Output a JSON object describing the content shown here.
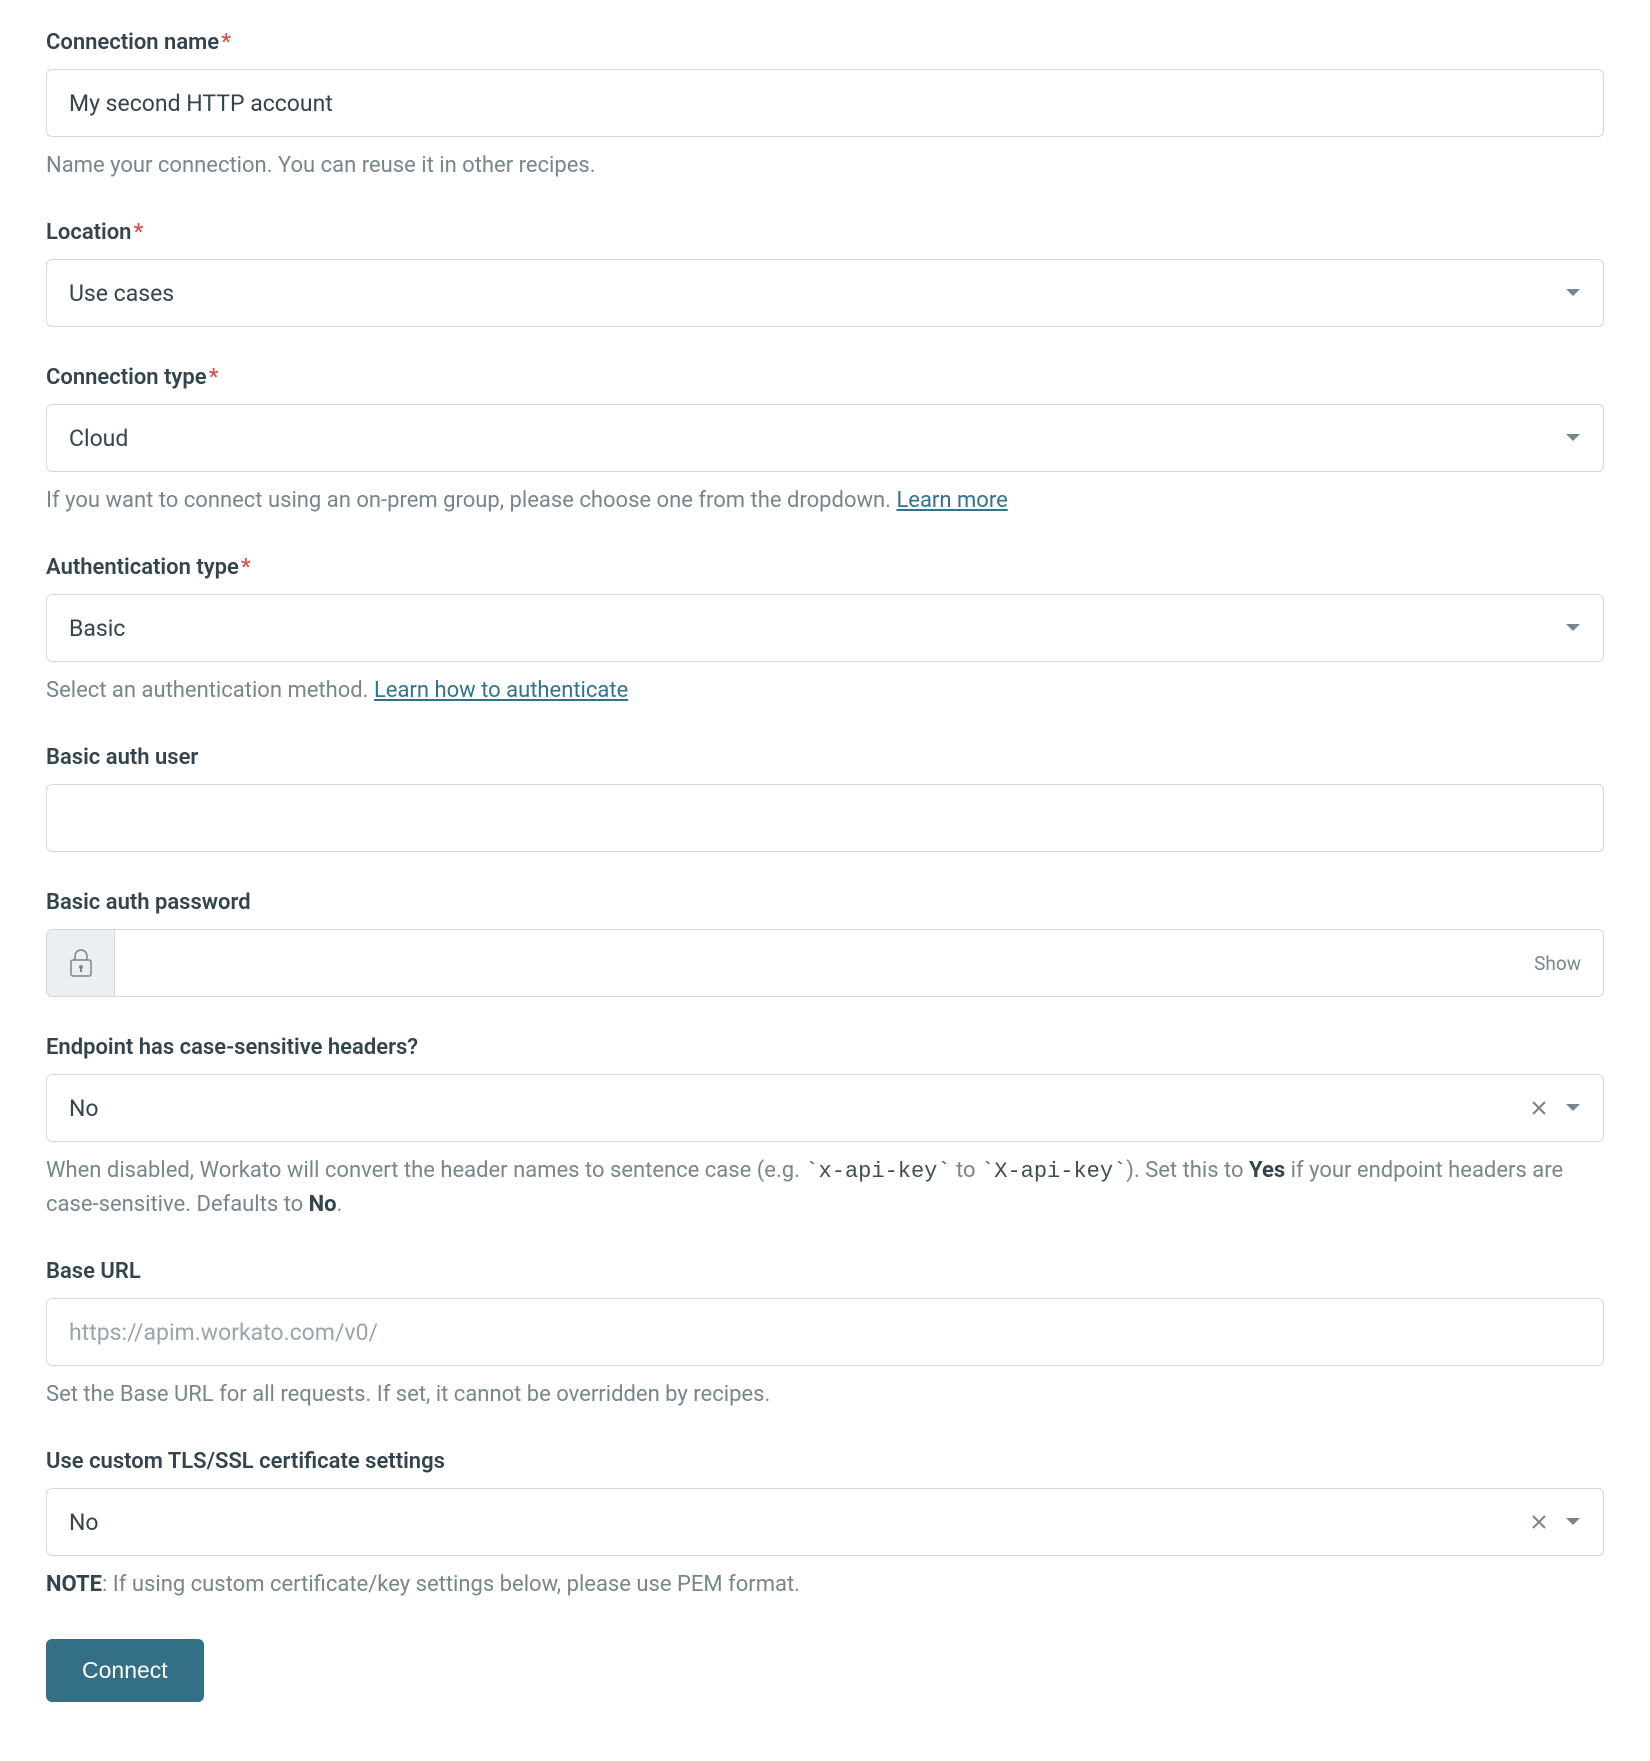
{
  "fields": {
    "connection_name": {
      "label": "Connection name",
      "required": true,
      "value": "My second HTTP account",
      "helper": "Name your connection. You can reuse it in other recipes."
    },
    "location": {
      "label": "Location",
      "required": true,
      "value": "Use cases"
    },
    "connection_type": {
      "label": "Connection type",
      "required": true,
      "value": "Cloud",
      "helper_prefix": "If you want to connect using an on-prem group, please choose one from the dropdown. ",
      "helper_link": "Learn more"
    },
    "auth_type": {
      "label": "Authentication type",
      "required": true,
      "value": "Basic",
      "helper_prefix": "Select an authentication method. ",
      "helper_link": "Learn how to authenticate"
    },
    "basic_auth_user": {
      "label": "Basic auth user",
      "value": ""
    },
    "basic_auth_password": {
      "label": "Basic auth password",
      "value": "",
      "show_label": "Show"
    },
    "case_sensitive_headers": {
      "label": "Endpoint has case-sensitive headers?",
      "value": "No",
      "helper_p1": "When disabled, Workato will convert the header names to sentence case (e.g. ",
      "helper_code1": "`x-api-key`",
      "helper_p2": " to ",
      "helper_code2": "`X-api-key`",
      "helper_p3": "). Set this to ",
      "helper_bold_yes": "Yes",
      "helper_p4": " if your endpoint headers are case-sensitive. Defaults to ",
      "helper_bold_no": "No",
      "helper_p5": "."
    },
    "base_url": {
      "label": "Base URL",
      "placeholder": "https://apim.workato.com/v0/",
      "value": "",
      "helper": "Set the Base URL for all requests. If set, it cannot be overridden by recipes."
    },
    "custom_tls": {
      "label": "Use custom TLS/SSL certificate settings",
      "value": "No",
      "helper_bold": "NOTE",
      "helper_rest": ": If using custom certificate/key settings below, please use PEM format."
    }
  },
  "connect_button": "Connect"
}
